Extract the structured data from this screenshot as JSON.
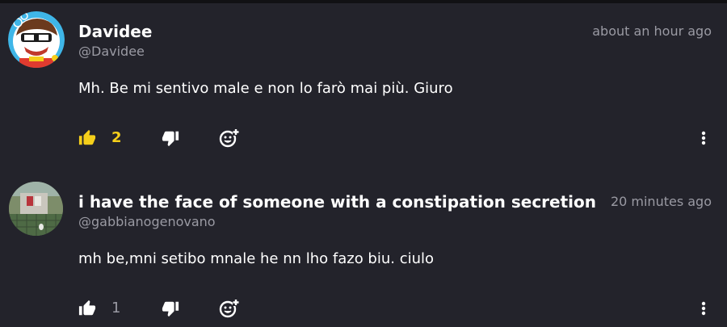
{
  "comments": [
    {
      "username": "Davidee",
      "handle": "@Davidee",
      "time": "about an hour ago",
      "text": "Mh. Be mi sentivo male e non lo farò mai più. Giuro",
      "likes": "2",
      "liked": true,
      "accent_color": "#f5cf1a"
    },
    {
      "username": "i have the face of someone with a constipation secretion",
      "handle": "@gabbianogenovano",
      "time": "20 minutes ago",
      "text": "mh be,mni setibo mnale he nn lho fazo biu. ciulo",
      "likes": "1",
      "liked": false,
      "accent_color": "#ffffff"
    }
  ],
  "icons": {
    "like": "thumbs-up-icon",
    "dislike": "thumbs-down-icon",
    "react": "add-reaction-icon",
    "more": "more-vertical-icon"
  },
  "colors": {
    "background": "#23232b",
    "text": "#ffffff",
    "muted": "#9a9aa3",
    "liked": "#f5cf1a"
  }
}
